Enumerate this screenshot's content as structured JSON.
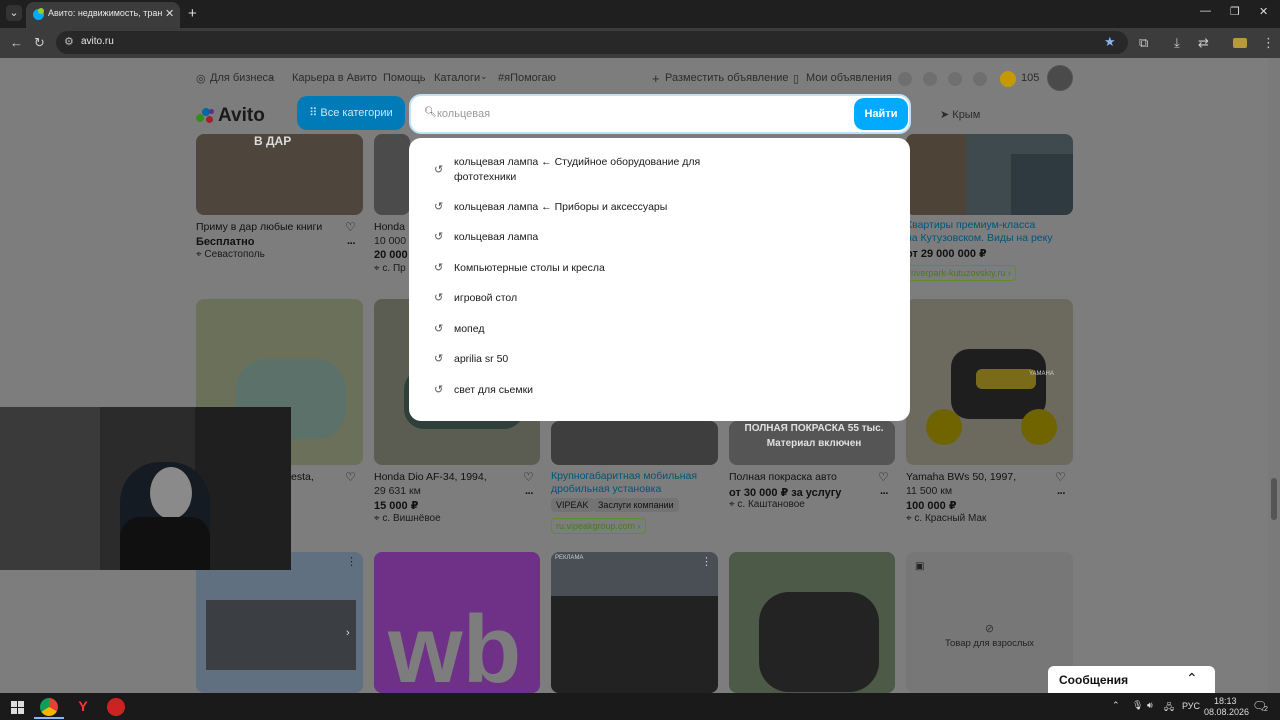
{
  "browser": {
    "tab_title": "Авито: недвижимость, трансп",
    "url": "avito.ru"
  },
  "header": {
    "business": "Для бизнеса",
    "career": "Карьера в Авито",
    "help": "Помощь",
    "catalogs": "Каталоги",
    "ipomogayu": "#яПомогаю",
    "place_ad": "Разместить объявление",
    "my_ads": "Мои объявления",
    "balance": "105",
    "logo": "Avito",
    "all_categories": "Все категории",
    "region": "Крым"
  },
  "search": {
    "placeholder": "кольцевая",
    "button": "Найти",
    "suggestions": [
      "кольцевая лампа ← Студийное оборудование для фототехники",
      "кольцевая лампа ← Приборы и аксессуары",
      "кольцевая лампа",
      "Компьютерные столы и кресла",
      "игровой стол",
      "мопед",
      "aprilia sr 50",
      "свет для сьемки"
    ]
  },
  "cards": {
    "c1": {
      "title": "Приму в дар любые книги",
      "price": "Бесплатно",
      "loc": "Севастополь",
      "img_text": "В ДАР"
    },
    "c2": {
      "title": "Honda",
      "price_line": "10 000",
      "price": "20 000",
      "loc": "с. Пр"
    },
    "c5": {
      "title_line1": "Квартиры премиум-класса",
      "title_line2": "на Кутузовском. Виды на реку",
      "price": "от 29 000 000 ₽",
      "link": "riverpark-kutuzovskiy.ru ›"
    },
    "c6": {
      "title": "esta,",
      "price": ""
    },
    "c7": {
      "title": "Honda Dio AF-34, 1994,",
      "sub": "29 631 км",
      "price": "15 000 ₽",
      "loc": "с. Вишнёвое"
    },
    "c8": {
      "title_line1": "Крупногабаритная мобильная",
      "title_line2": "дробильная установка",
      "chip1": "VIPEAK",
      "chip2": "Заслуги компании",
      "link": "ru.vipeakgroup.com ›"
    },
    "c9": {
      "img_line1": "ПОЛНАЯ ПОКРАСКА 55 тыс.",
      "img_line2": "Материал включен",
      "title": "Полная покраска авто",
      "price": "от 30 000 ₽ за услугу",
      "loc": "с. Каштановое"
    },
    "c10": {
      "title": "Yamaha BWs 50, 1997,",
      "sub": "11 500 км",
      "price": "100 000 ₽",
      "loc": "с. Красный Мак",
      "img_text": "YAMAHA"
    },
    "c11": {
      "text": "wb"
    },
    "c12": {
      "label": "РЕКЛАМА"
    },
    "c14": {
      "text": "Товар для взрослых"
    }
  },
  "messages": {
    "label": "Сообщения"
  },
  "taskbar": {
    "lang": "РУС",
    "time": "18:13",
    "date": "08.08.2026",
    "notif": "2"
  },
  "colors": {
    "accent": "#00aaff",
    "brand_green": "#97cf26",
    "brand_red": "#ff4053",
    "brand_purple": "#965eeb"
  }
}
